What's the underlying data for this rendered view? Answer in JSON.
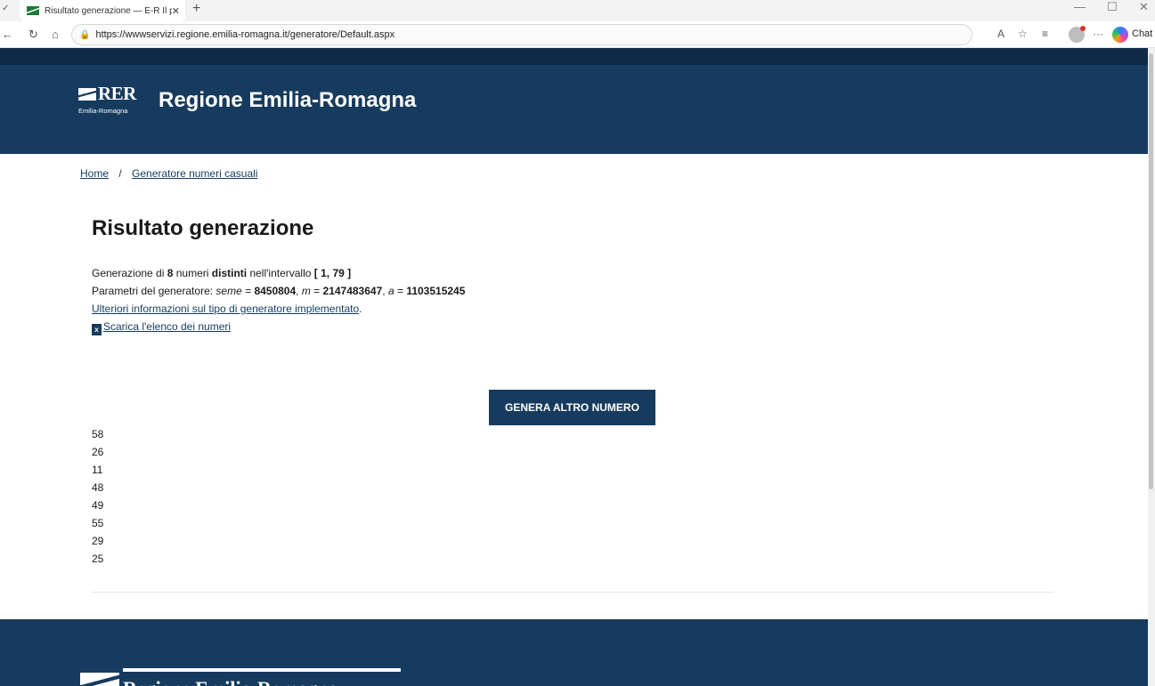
{
  "browser": {
    "tab_title": "Risultato generazione — E-R Il por",
    "tab_close": "✕",
    "new_tab": "+",
    "url": "https://wwwservizi.regione.emilia-romagna.it/generatore/Default.aspx",
    "chat_label": "Chat"
  },
  "header": {
    "logo_text": "RER",
    "logo_sub": "Emilia-Romagna",
    "site_title": "Regione Emilia-Romagna"
  },
  "breadcrumb": {
    "home": "Home",
    "separator": "/",
    "current": "Generatore numeri casuali"
  },
  "main": {
    "title": "Risultato generazione",
    "line1": {
      "prefix": "Generazione di ",
      "count": "8",
      "middle": " numeri ",
      "distinct": "distinti",
      "suffix": " nell'intervallo ",
      "interval": "[ 1, 79 ]"
    },
    "line2": {
      "prefix": "Parametri del generatore: ",
      "seme_label": "seme",
      "eq1": " = ",
      "seme_value": "8450804",
      "sep1": ", ",
      "m_label": "m",
      "eq2": " = ",
      "m_value": "2147483647",
      "sep2": ", ",
      "a_label": "a",
      "eq3": " = ",
      "a_value": "1103515245"
    },
    "info_link": "Ulteriori informazioni sul tipo di generatore implementato",
    "info_link_suffix": ".",
    "download_icon": "x",
    "download_link": "Scarica l'elenco dei numeri",
    "generate_button": "GENERA ALTRO NUMERO",
    "numbers": [
      "58",
      "26",
      "11",
      "48",
      "49",
      "55",
      "29",
      "25"
    ]
  },
  "footer": {
    "logo_text": "Regione Emilia-Romagna"
  },
  "colors": {
    "header_bg": "#163b5e",
    "top_strip": "#0f2a47",
    "button_bg": "#163b5e"
  }
}
